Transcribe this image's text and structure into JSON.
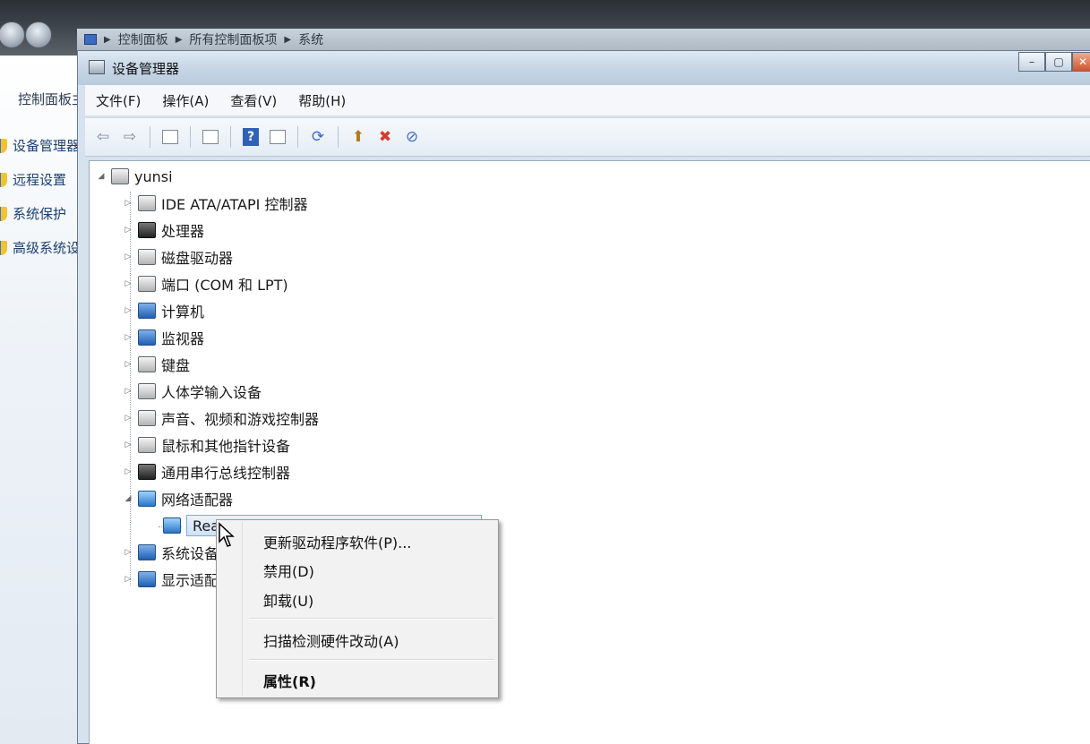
{
  "background_window": {
    "breadcrumb": [
      "控制面板",
      "所有控制面板项",
      "系统"
    ],
    "left_panel_title": "控制面板主页",
    "left_links": [
      "设备管理器",
      "远程设置",
      "系统保护",
      "高级系统设置"
    ]
  },
  "device_manager": {
    "title": "设备管理器",
    "window_controls": {
      "minimize": "–",
      "maximize": "▢",
      "close": "✕"
    },
    "menu": [
      "文件(F)",
      "操作(A)",
      "查看(V)",
      "帮助(H)"
    ],
    "toolbar_icons": [
      "back-icon",
      "forward-icon",
      "show-hide-tree-icon",
      "properties-icon",
      "help-icon",
      "view-icon",
      "scan-hardware-icon",
      "update-driver-icon",
      "uninstall-icon",
      "disable-icon"
    ],
    "tree": {
      "root": "yunsi",
      "categories": [
        {
          "label": "IDE ATA/ATAPI 控制器",
          "icon": "ide-controller-icon",
          "expanded": false
        },
        {
          "label": "处理器",
          "icon": "processor-icon",
          "expanded": false
        },
        {
          "label": "磁盘驱动器",
          "icon": "disk-drive-icon",
          "expanded": false
        },
        {
          "label": "端口 (COM 和 LPT)",
          "icon": "port-icon",
          "expanded": false
        },
        {
          "label": "计算机",
          "icon": "computer-icon",
          "expanded": false
        },
        {
          "label": "监视器",
          "icon": "monitor-icon",
          "expanded": false
        },
        {
          "label": "键盘",
          "icon": "keyboard-icon",
          "expanded": false
        },
        {
          "label": "人体学输入设备",
          "icon": "hid-icon",
          "expanded": false
        },
        {
          "label": "声音、视频和游戏控制器",
          "icon": "speaker-icon",
          "expanded": false
        },
        {
          "label": "鼠标和其他指针设备",
          "icon": "mouse-icon",
          "expanded": false
        },
        {
          "label": "通用串行总线控制器",
          "icon": "usb-icon",
          "expanded": false
        },
        {
          "label": "网络适配器",
          "icon": "network-adapter-icon",
          "expanded": true
        },
        {
          "label": "系统设备",
          "icon": "system-device-icon",
          "expanded": false
        },
        {
          "label": "显示适配器",
          "icon": "display-adapter-icon",
          "expanded": false
        }
      ],
      "selected_child": "Realtek PCIe GBE Family Controller"
    }
  },
  "context_menu": {
    "items": [
      "更新驱动程序软件(P)...",
      "禁用(D)",
      "卸载(U)",
      "扫描检测硬件改动(A)",
      "属性(R)"
    ]
  }
}
